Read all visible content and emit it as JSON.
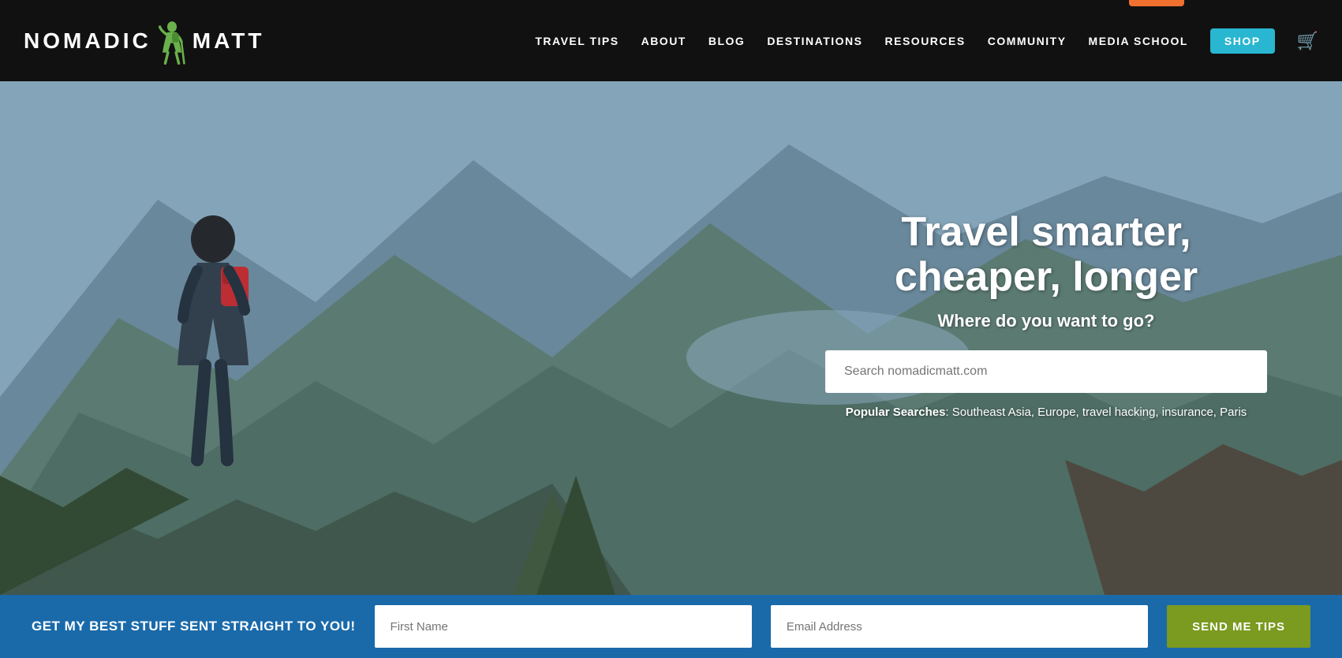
{
  "header": {
    "logo_nomadic": "NoMADIC",
    "logo_matt": "MATT",
    "nav_items": [
      {
        "label": "TRAVEL TIPS",
        "id": "travel-tips"
      },
      {
        "label": "ABOUT",
        "id": "about"
      },
      {
        "label": "BLOG",
        "id": "blog"
      },
      {
        "label": "DESTINATIONS",
        "id": "destinations"
      },
      {
        "label": "RESOURCES",
        "id": "resources"
      },
      {
        "label": "COMMUNITY",
        "id": "community"
      },
      {
        "label": "MEDIA SCHOOL",
        "id": "media-school"
      }
    ],
    "shop_label": "SHOP",
    "cart_icon": "🛒"
  },
  "hero": {
    "title": "Travel smarter, cheaper, longer",
    "subtitle": "Where do you want to go?",
    "search_placeholder": "Search nomadicmatt.com",
    "popular_label": "Popular Searches",
    "popular_items": ": Southeast Asia, Europe, travel hacking, insurance, Paris"
  },
  "bottom_bar": {
    "cta_text": "GET MY BEST STUFF SENT STRAIGHT TO YOU!",
    "first_name_placeholder": "First Name",
    "email_placeholder": "Email Address",
    "send_label": "SEND ME TIPS"
  }
}
